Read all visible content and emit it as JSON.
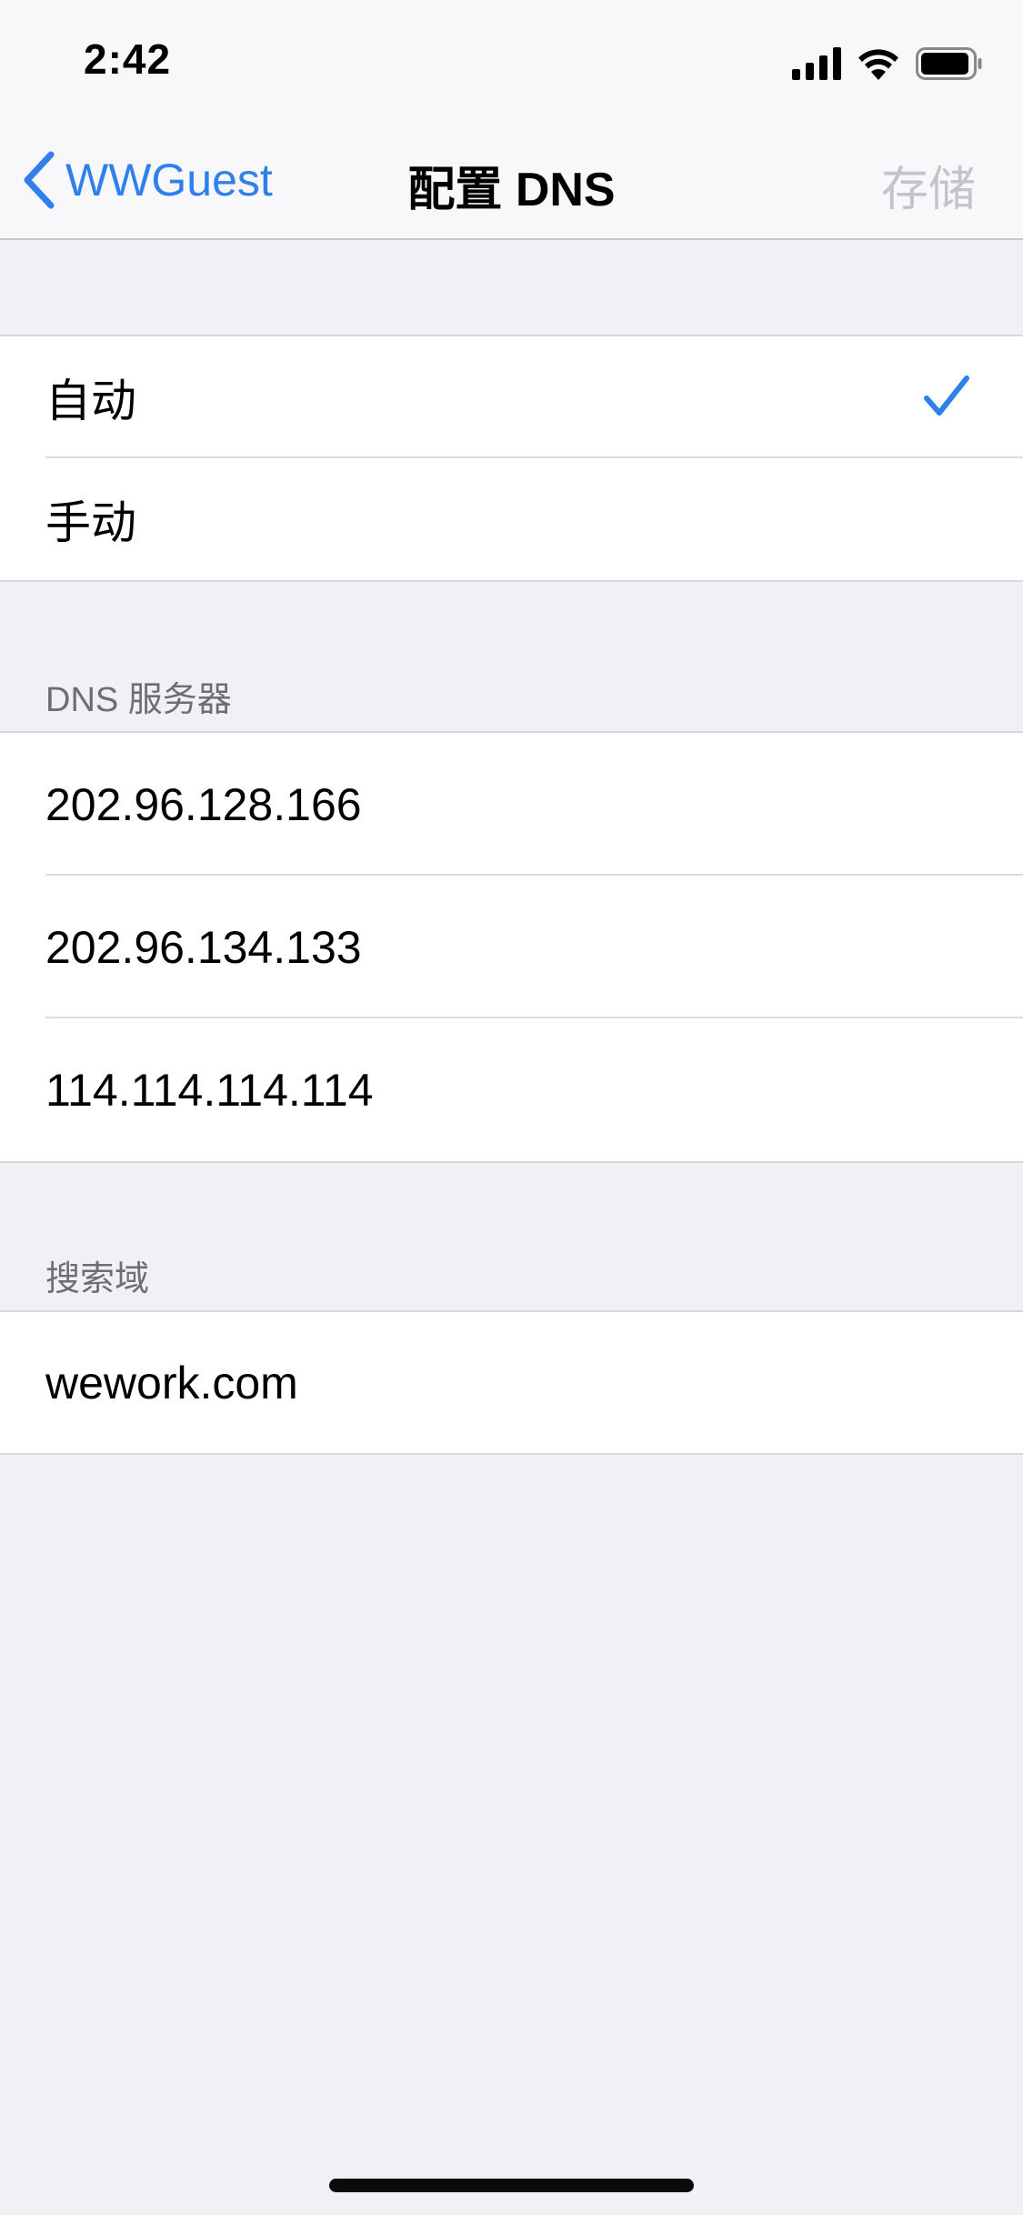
{
  "status_bar": {
    "time": "2:42",
    "icons": [
      "cellular-signal-icon",
      "wifi-icon",
      "battery-icon"
    ]
  },
  "nav": {
    "back_label": "WWGuest",
    "back_icon": "chevron-left-icon",
    "title": "配置 DNS",
    "save_label": "存储"
  },
  "mode_options": [
    {
      "label": "自动",
      "selected": true
    },
    {
      "label": "手动",
      "selected": false
    }
  ],
  "dns_section": {
    "header": "DNS 服务器",
    "servers": [
      "202.96.128.166",
      "202.96.134.133",
      "114.114.114.114"
    ]
  },
  "search_section": {
    "header": "搜索域",
    "domains": [
      "wework.com"
    ]
  },
  "colors": {
    "accent": "#2f80ed",
    "background": "#f0f0f5",
    "disabled": "#c4c4c8",
    "section_header": "#6d6d72"
  }
}
